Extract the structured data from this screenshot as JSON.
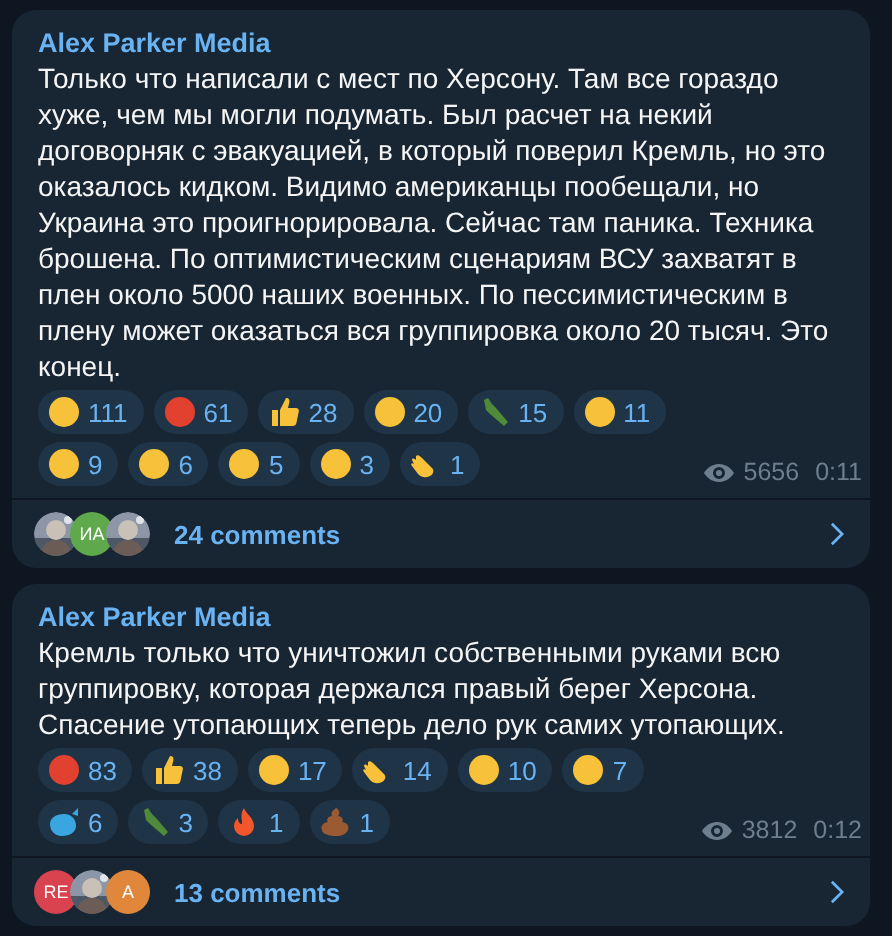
{
  "posts": [
    {
      "author": "Alex Parker Media",
      "text": "Только что написали с мест по Херсону. Там все гораздо хуже, чем мы могли подумать. Был расчет на некий договорняк с эвакуацией, в который поверил Кремль, но это оказалось кидком. Видимо американцы пообещали, но Украина это проигнорировала. Сейчас там паника. Техника брошена. По оптимистическим сценариям ВСУ захватят в плен около 5000 наших военных. По пессимистическим в плену может оказаться вся группировка около 20 тысяч. Это конец.",
      "reactions": [
        {
          "kind": "face",
          "count": "111"
        },
        {
          "kind": "angry",
          "count": "61"
        },
        {
          "kind": "thumb",
          "count": "28"
        },
        {
          "kind": "face",
          "count": "20"
        },
        {
          "kind": "bottle",
          "count": "15"
        },
        {
          "kind": "face",
          "count": "11"
        },
        {
          "kind": "face",
          "count": "9"
        },
        {
          "kind": "face",
          "count": "6"
        },
        {
          "kind": "face",
          "count": "5"
        },
        {
          "kind": "face",
          "count": "3"
        },
        {
          "kind": "clap",
          "count": "1"
        }
      ],
      "views": "5656",
      "time": "0:11",
      "avatars": [
        {
          "kind": "picture"
        },
        {
          "kind": "letters",
          "text": "ИА",
          "color": "#5fa84c"
        },
        {
          "kind": "picture"
        }
      ],
      "comments": "24 comments"
    },
    {
      "author": "Alex Parker Media",
      "text": "Кремль только что уничтожил собственными руками всю группировку, которая держался правый берег Херсона. Спасение утопающих теперь дело рук самих утопающих.",
      "reactions": [
        {
          "kind": "angry",
          "count": "83"
        },
        {
          "kind": "thumb",
          "count": "38"
        },
        {
          "kind": "face",
          "count": "17"
        },
        {
          "kind": "clap",
          "count": "14"
        },
        {
          "kind": "face",
          "count": "10"
        },
        {
          "kind": "face",
          "count": "7"
        },
        {
          "kind": "whale",
          "count": "6"
        },
        {
          "kind": "bottle",
          "count": "3"
        },
        {
          "kind": "fire",
          "count": "1"
        },
        {
          "kind": "poo",
          "count": "1"
        }
      ],
      "views": "3812",
      "time": "0:12",
      "avatars": [
        {
          "kind": "letters",
          "text": "RE",
          "color": "#d9434f"
        },
        {
          "kind": "picture"
        },
        {
          "kind": "letters",
          "text": "A",
          "color": "#e0873c"
        }
      ],
      "comments": "13 comments"
    }
  ]
}
